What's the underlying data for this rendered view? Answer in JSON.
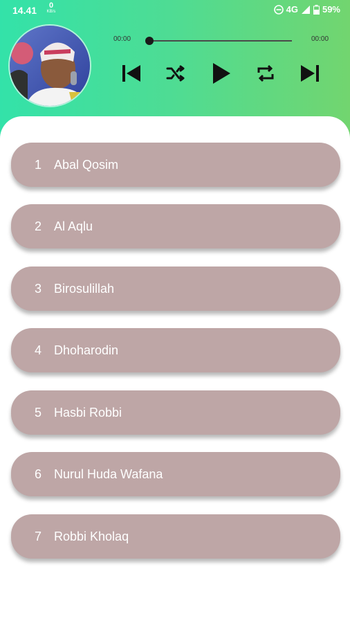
{
  "status_bar": {
    "time": "14.41",
    "net_speed_value": "0",
    "net_speed_unit": "KB/s",
    "network": "4G",
    "battery": "59%"
  },
  "player": {
    "current_time": "00:00",
    "total_time": "00:00",
    "progress": 0,
    "controls": {
      "previous": "skip-previous-icon",
      "shuffle": "shuffle-icon",
      "play": "play-icon",
      "repeat": "repeat-icon",
      "next": "skip-next-icon"
    }
  },
  "tracks": [
    {
      "number": "1",
      "title": "Abal Qosim"
    },
    {
      "number": "2",
      "title": "Al Aqlu"
    },
    {
      "number": "3",
      "title": "Birosulillah"
    },
    {
      "number": "4",
      "title": "Dhoharodin"
    },
    {
      "number": "5",
      "title": "Hasbi Robbi"
    },
    {
      "number": "6",
      "title": "Nurul Huda Wafana"
    },
    {
      "number": "7",
      "title": "Robbi Kholaq"
    }
  ],
  "colors": {
    "header_gradient_start": "#33e2a9",
    "header_gradient_end": "#72d56f",
    "track_item_bg": "#bea6a6",
    "track_text": "#ffffff"
  }
}
